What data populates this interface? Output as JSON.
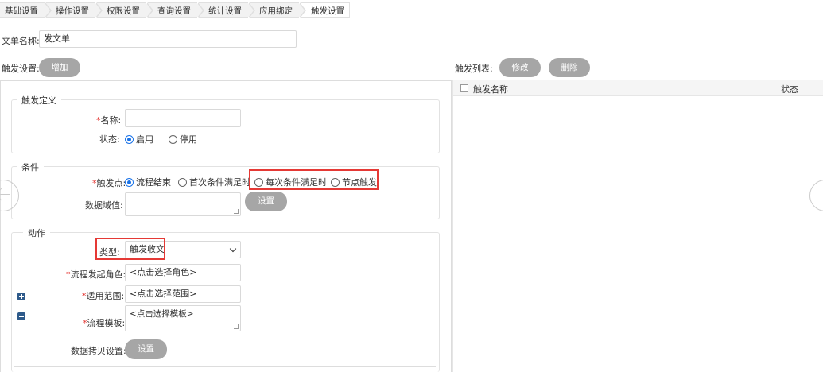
{
  "breadcrumb": [
    "基础设置",
    "操作设置",
    "权限设置",
    "查询设置",
    "统计设置",
    "应用绑定",
    "触发设置"
  ],
  "doc_name": {
    "label": "文单名称:",
    "value": "发文单"
  },
  "trigger_setting": {
    "label": "触发设置:",
    "add_button": "增加"
  },
  "trigger_list": {
    "label": "触发列表:",
    "edit_button": "修改",
    "delete_button": "删除",
    "columns": [
      "触发名称",
      "状态"
    ]
  },
  "definition": {
    "legend": "触发定义",
    "name_label": "名称:",
    "required_mark": "*",
    "status_label": "状态:",
    "status_options": [
      "启用",
      "停用"
    ]
  },
  "condition": {
    "legend": "条件",
    "trigger_point_label": "触发点:",
    "trigger_point_options": [
      "流程结束",
      "首次条件满足时",
      "每次条件满足时",
      "节点触发"
    ],
    "data_field_label": "数据域值:",
    "setting_button": "设置"
  },
  "action": {
    "legend": "动作",
    "type_label": "类型:",
    "type_value": "触发收文",
    "initiator_label": "流程发起角色:",
    "initiator_value": "<点击选择角色>",
    "scope_label": "适用范围:",
    "scope_value": "<点击选择范围>",
    "template_label": "流程模板:",
    "template_value": "<点击选择模板>",
    "copy_label": "数据拷贝设置:",
    "copy_button": "设置"
  },
  "colors": {
    "button_gray": "#a6a6a6",
    "highlight_red": "#e53935",
    "radio_blue": "#1a73e8"
  }
}
